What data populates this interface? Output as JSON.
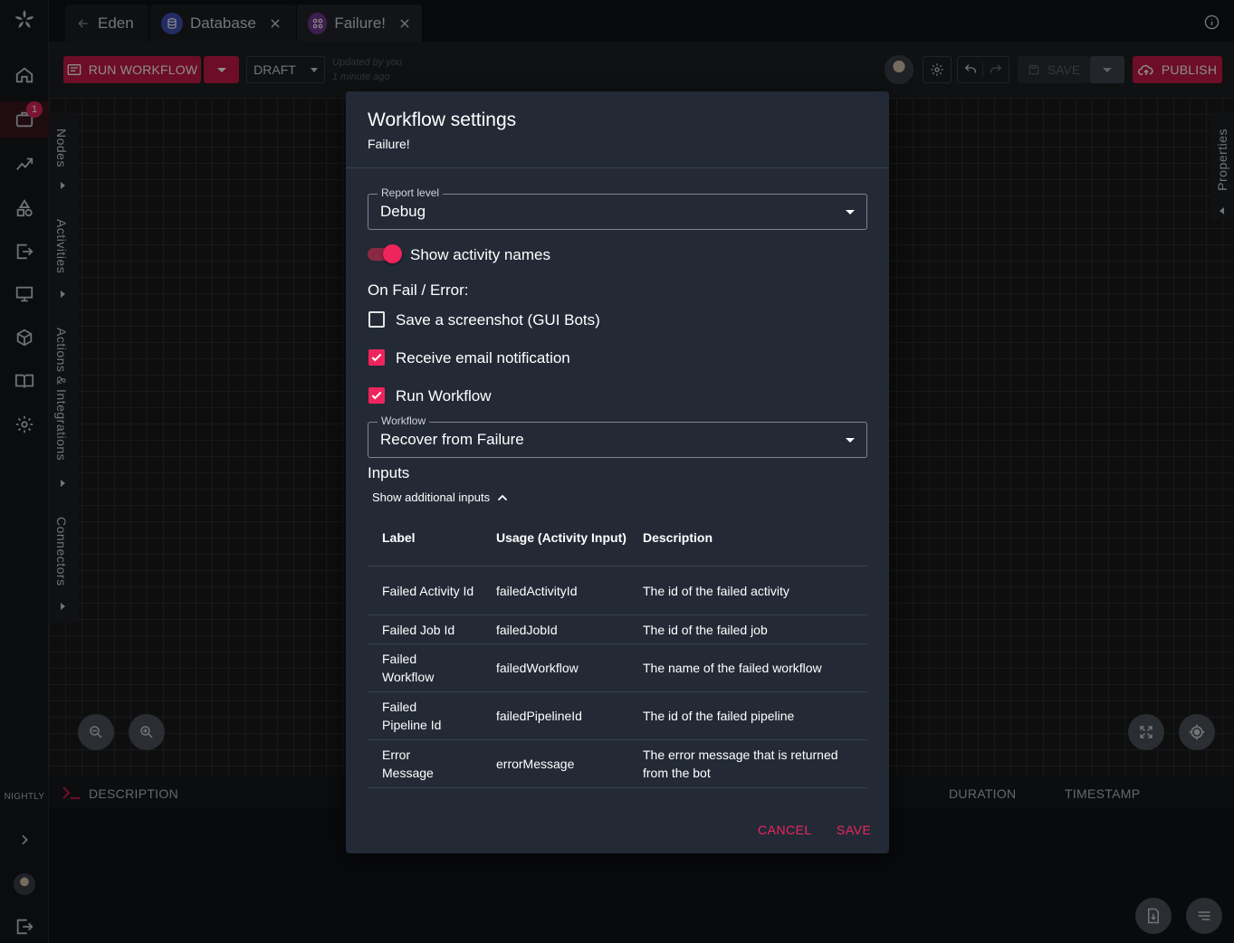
{
  "rail": {
    "badge_count": "1",
    "env_label": "NIGHTLY",
    "icons": [
      "home-icon",
      "briefcase-icon",
      "analytics-icon",
      "shapes-icon",
      "export-icon",
      "monitor-icon",
      "cube-icon",
      "book-icon",
      "gear-icon"
    ]
  },
  "tabs": [
    {
      "label": "Eden"
    },
    {
      "label": "Database"
    },
    {
      "label": "Failure!"
    }
  ],
  "toolbar": {
    "run_label": "RUN WORKFLOW",
    "draft_label": "DRAFT",
    "updated_line1": "Updated by you",
    "updated_line2": "1 minute ago",
    "save_label": "SAVE",
    "publish_label": "PUBLISH"
  },
  "side_panels": {
    "nodes": "Nodes",
    "activities": "Activities",
    "actions": "Actions & Integrations",
    "connectors": "Connectors",
    "properties": "Properties"
  },
  "log_bar": {
    "description": "DESCRIPTION",
    "duration": "DURATION",
    "timestamp": "TIMESTAMP"
  },
  "modal": {
    "title": "Workflow settings",
    "subtitle": "Failure!",
    "report_level": {
      "label": "Report level",
      "value": "Debug"
    },
    "show_activity_names": {
      "label": "Show activity names",
      "checked": true
    },
    "on_fail_heading": "On Fail / Error:",
    "save_screenshot": {
      "label": "Save a screenshot (GUI Bots)",
      "checked": false
    },
    "email_notification": {
      "label": "Receive email notification",
      "checked": true
    },
    "run_workflow": {
      "label": "Run Workflow",
      "checked": true
    },
    "workflow": {
      "label": "Workflow",
      "value": "Recover from Failure"
    },
    "inputs_heading": "Inputs",
    "show_additional": "Show additional inputs",
    "table": {
      "headers": [
        "Label",
        "Usage (Activity Input)",
        "Description"
      ],
      "rows": [
        [
          "Failed Activity Id",
          "failedActivityId",
          "The id of the failed activity"
        ],
        [
          "Failed Job Id",
          "failedJobId",
          "The id of the failed job"
        ],
        [
          "Failed Workflow",
          "failedWorkflow",
          "The name of the failed workflow"
        ],
        [
          "Failed Pipeline Id",
          "failedPipelineId",
          "The id of the failed pipeline"
        ],
        [
          "Error Message",
          "errorMessage",
          "The error message that is returned from the bot"
        ]
      ]
    },
    "cancel_label": "CANCEL",
    "save_label": "SAVE"
  },
  "colors": {
    "accent": "#f0245d",
    "brand_red": "#c61b45",
    "modal_bg": "#232a36"
  }
}
